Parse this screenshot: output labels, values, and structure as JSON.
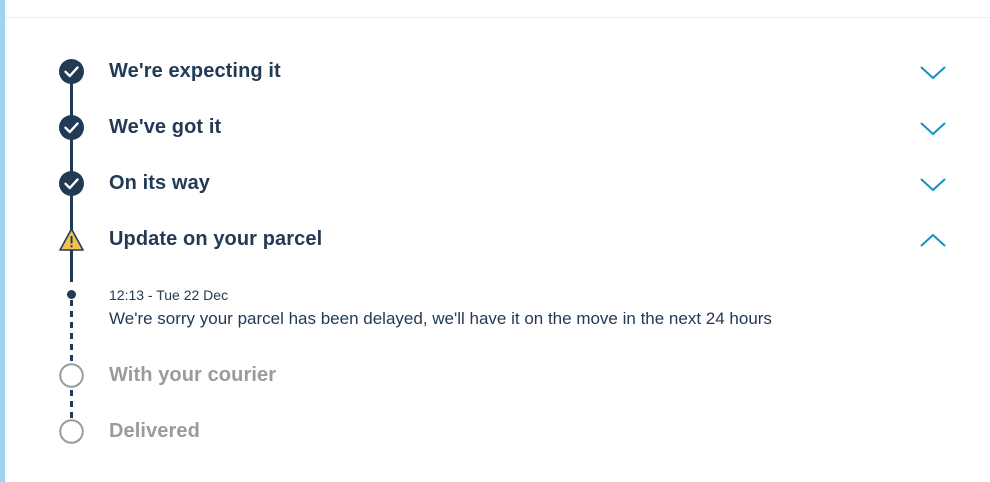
{
  "tracker": {
    "steps": [
      {
        "label": "We're expecting it",
        "status": "complete",
        "toggle": "collapsed"
      },
      {
        "label": "We've got it",
        "status": "complete",
        "toggle": "collapsed"
      },
      {
        "label": "On its way",
        "status": "complete",
        "toggle": "collapsed"
      },
      {
        "label": "Update on your parcel",
        "status": "warning",
        "toggle": "expanded"
      },
      {
        "label": "With your courier",
        "status": "pending"
      },
      {
        "label": "Delivered",
        "status": "pending"
      }
    ],
    "update": {
      "timestamp": "12:13 - Tue 22 Dec",
      "message": "We're sorry your parcel has been delayed, we'll have it on the move in the next 24 hours"
    }
  },
  "icons": {
    "complete": "check-circle-icon",
    "warning": "warning-triangle-icon",
    "pending": "empty-circle-icon",
    "collapsed": "chevron-down-icon",
    "expanded": "chevron-up-icon"
  },
  "colors": {
    "navy": "#233a55",
    "accent": "#1a8fc4",
    "warning": "#f2c14e",
    "pending": "#9b9b9b",
    "left_border": "#9fd3ef"
  }
}
